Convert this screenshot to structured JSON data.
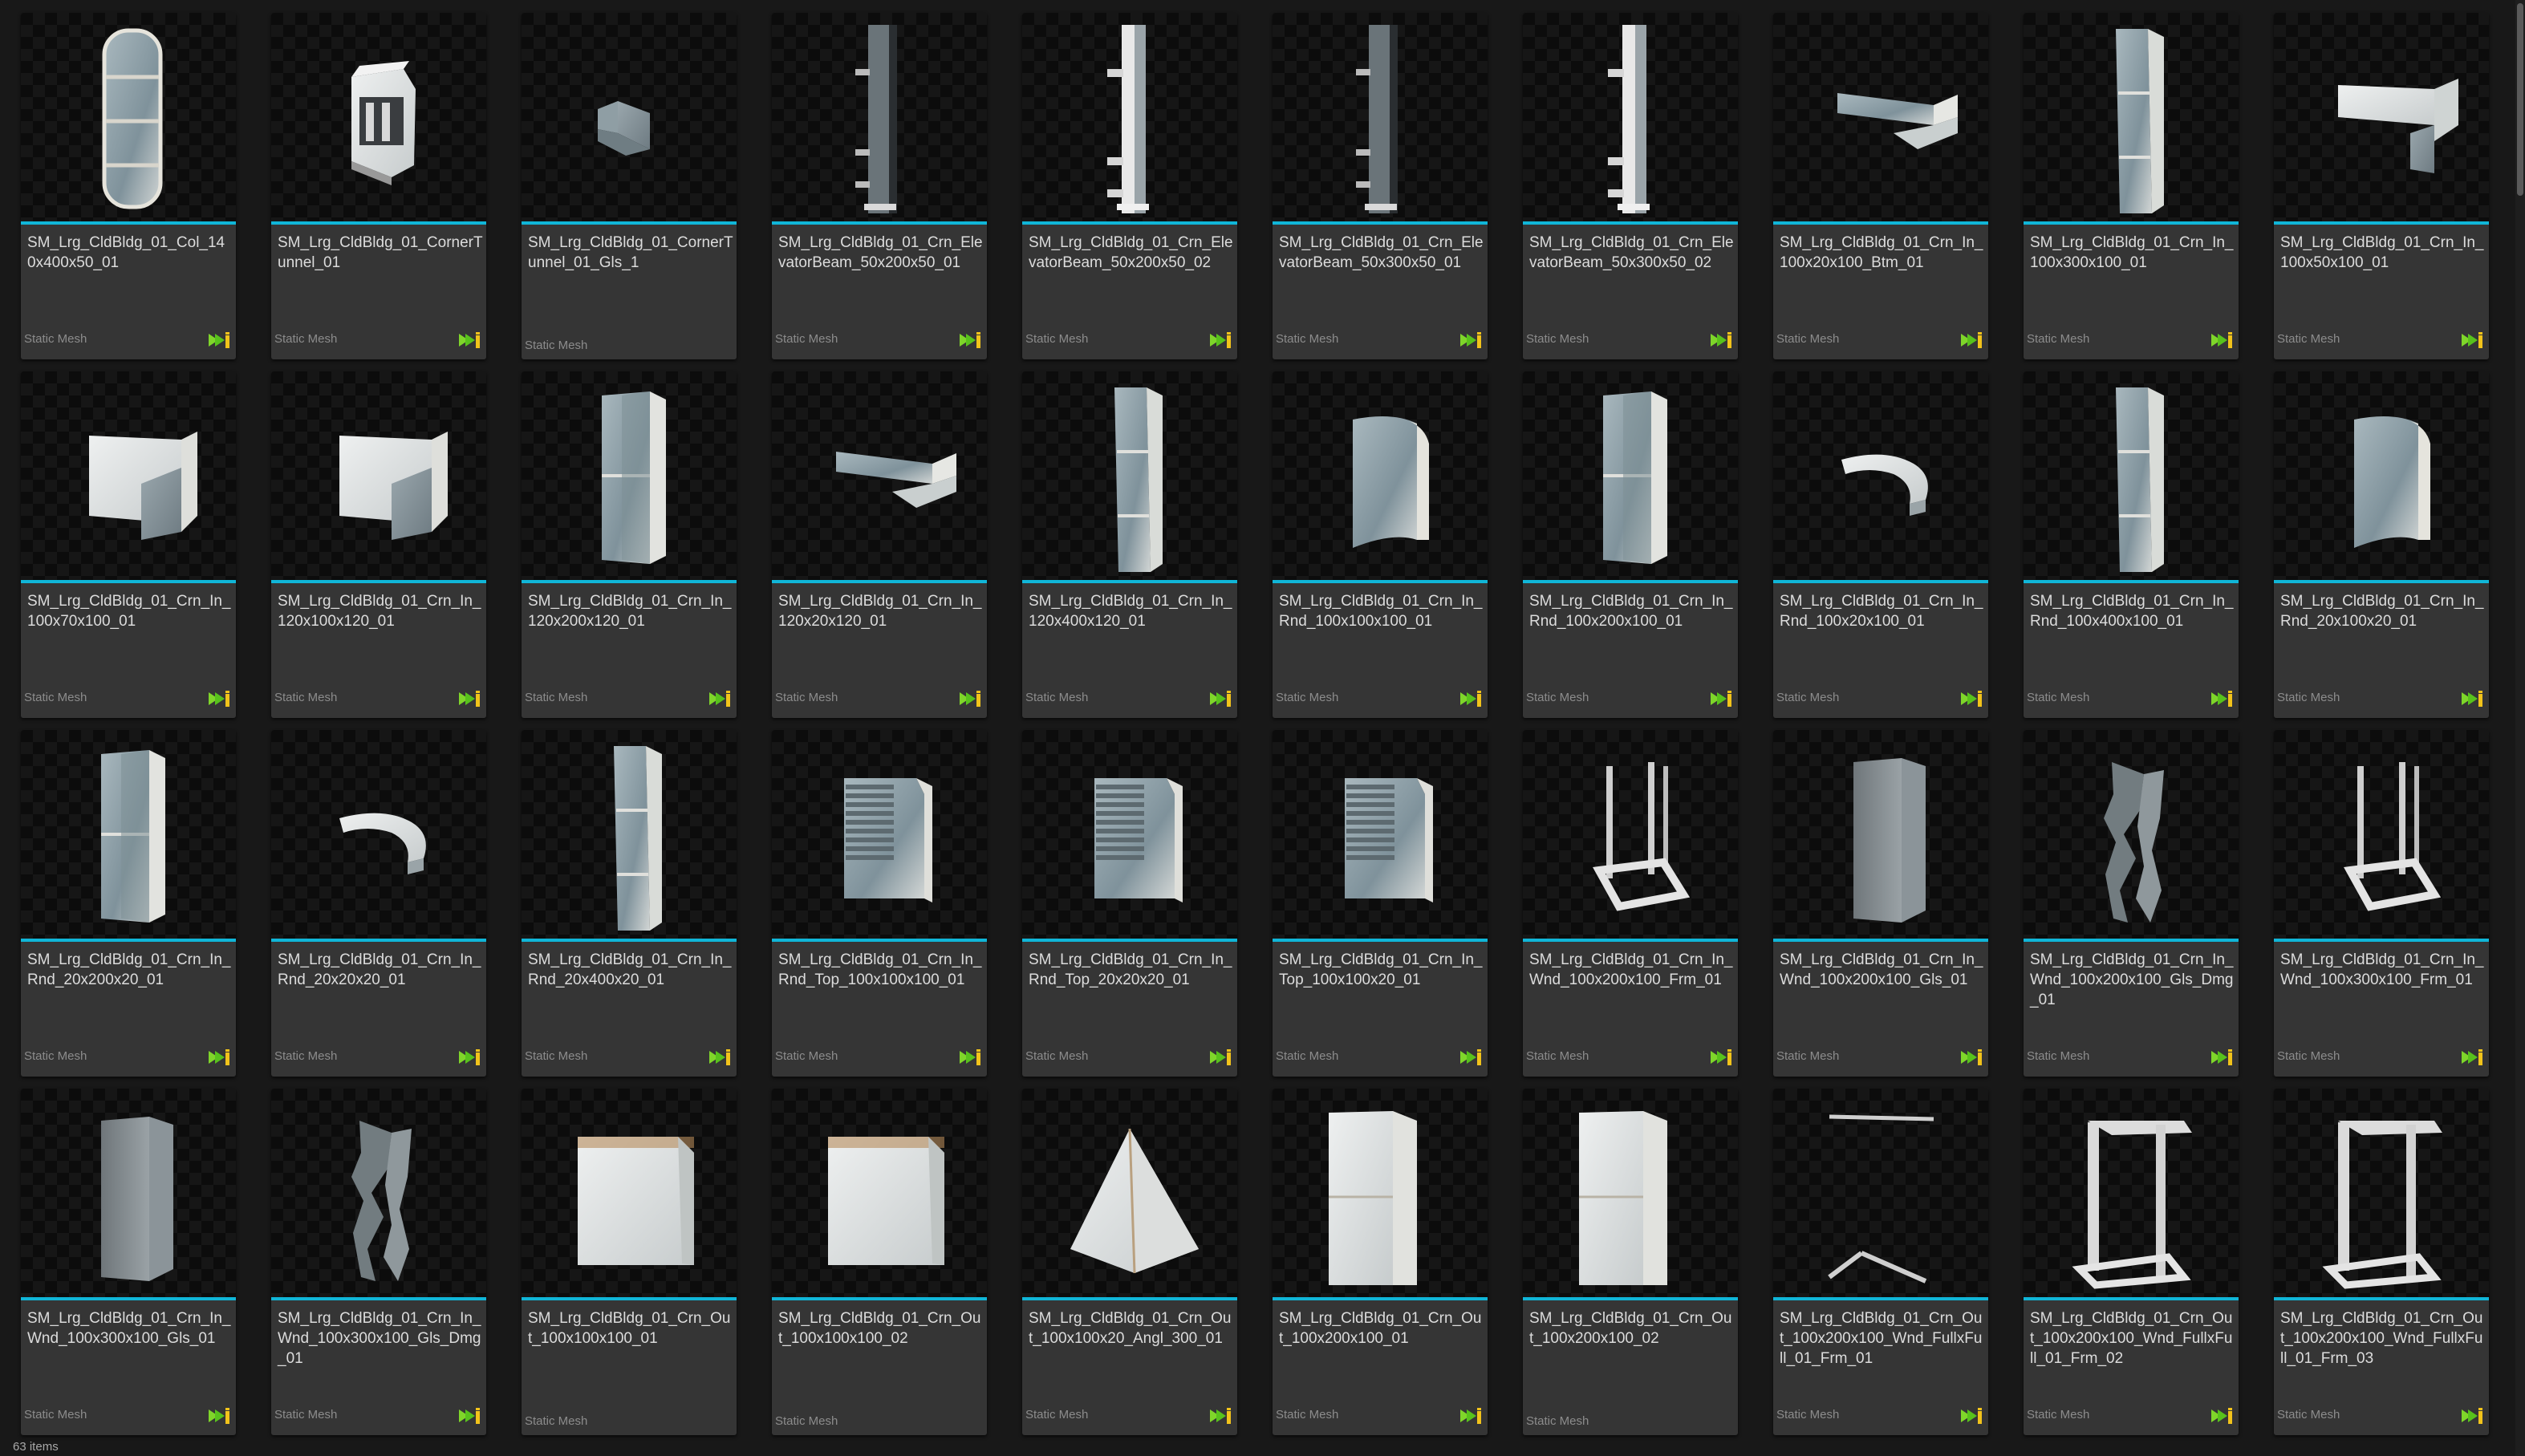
{
  "asset_type_label": "Static Mesh",
  "accent_color": "#10b6d8",
  "footer": {
    "item_count": "63 items"
  },
  "assets": [
    {
      "name": "SM_Lrg_CldBldg_01_Col_140x400x50_01",
      "shape": "column"
    },
    {
      "name": "SM_Lrg_CldBldg_01_CornerTunnel_01",
      "shape": "tunnel"
    },
    {
      "name": "SM_Lrg_CldBldg_01_CornerTunnel_01_Gls_1",
      "shape": "smallbracket",
      "no_badge": true
    },
    {
      "name": "SM_Lrg_CldBldg_01_Crn_ElevatorBeam_50x200x50_01",
      "shape": "beam"
    },
    {
      "name": "SM_Lrg_CldBldg_01_Crn_ElevatorBeam_50x200x50_02",
      "shape": "beamwhite"
    },
    {
      "name": "SM_Lrg_CldBldg_01_Crn_ElevatorBeam_50x300x50_01",
      "shape": "beam"
    },
    {
      "name": "SM_Lrg_CldBldg_01_Crn_ElevatorBeam_50x300x50_02",
      "shape": "beamwhite"
    },
    {
      "name": "SM_Lrg_CldBldg_01_Crn_In_100x20x100_Btm_01",
      "shape": "lthin"
    },
    {
      "name": "SM_Lrg_CldBldg_01_Crn_In_100x300x100_01",
      "shape": "tallpanel"
    },
    {
      "name": "SM_Lrg_CldBldg_01_Crn_In_100x50x100_01",
      "shape": "lshort"
    },
    {
      "name": "SM_Lrg_CldBldg_01_Crn_In_100x70x100_01",
      "shape": "cube"
    },
    {
      "name": "SM_Lrg_CldBldg_01_Crn_In_120x100x120_01",
      "shape": "cube"
    },
    {
      "name": "SM_Lrg_CldBldg_01_Crn_In_120x200x120_01",
      "shape": "tallsplit"
    },
    {
      "name": "SM_Lrg_CldBldg_01_Crn_In_120x20x120_01",
      "shape": "lthin"
    },
    {
      "name": "SM_Lrg_CldBldg_01_Crn_In_120x400x120_01",
      "shape": "tallpanel"
    },
    {
      "name": "SM_Lrg_CldBldg_01_Crn_In_Rnd_100x100x100_01",
      "shape": "round"
    },
    {
      "name": "SM_Lrg_CldBldg_01_Crn_In_Rnd_100x200x100_01",
      "shape": "tallsplit"
    },
    {
      "name": "SM_Lrg_CldBldg_01_Crn_In_Rnd_100x20x100_01",
      "shape": "roundthin"
    },
    {
      "name": "SM_Lrg_CldBldg_01_Crn_In_Rnd_100x400x100_01",
      "shape": "tallpanel"
    },
    {
      "name": "SM_Lrg_CldBldg_01_Crn_In_Rnd_20x100x20_01",
      "shape": "round"
    },
    {
      "name": "SM_Lrg_CldBldg_01_Crn_In_Rnd_20x200x20_01",
      "shape": "tallsplit"
    },
    {
      "name": "SM_Lrg_CldBldg_01_Crn_In_Rnd_20x20x20_01",
      "shape": "roundthin"
    },
    {
      "name": "SM_Lrg_CldBldg_01_Crn_In_Rnd_20x400x20_01",
      "shape": "tallpanel"
    },
    {
      "name": "SM_Lrg_CldBldg_01_Crn_In_Rnd_Top_100x100x100_01",
      "shape": "vent"
    },
    {
      "name": "SM_Lrg_CldBldg_01_Crn_In_Rnd_Top_20x20x20_01",
      "shape": "vent"
    },
    {
      "name": "SM_Lrg_CldBldg_01_Crn_In_Top_100x100x20_01",
      "shape": "vent"
    },
    {
      "name": "SM_Lrg_CldBldg_01_Crn_In_Wnd_100x200x100_Frm_01",
      "shape": "frame"
    },
    {
      "name": "SM_Lrg_CldBldg_01_Crn_In_Wnd_100x200x100_Gls_01",
      "shape": "glass"
    },
    {
      "name": "SM_Lrg_CldBldg_01_Crn_In_Wnd_100x200x100_Gls_Dmg_01",
      "shape": "broken"
    },
    {
      "name": "SM_Lrg_CldBldg_01_Crn_In_Wnd_100x300x100_Frm_01",
      "shape": "frame"
    },
    {
      "name": "SM_Lrg_CldBldg_01_Crn_In_Wnd_100x300x100_Gls_01",
      "shape": "glass"
    },
    {
      "name": "SM_Lrg_CldBldg_01_Crn_In_Wnd_100x300x100_Gls_Dmg_01",
      "shape": "broken"
    },
    {
      "name": "SM_Lrg_CldBldg_01_Crn_Out_100x100x100_01",
      "shape": "outcube",
      "no_badge": true
    },
    {
      "name": "SM_Lrg_CldBldg_01_Crn_Out_100x100x100_02",
      "shape": "outcube",
      "no_badge": true
    },
    {
      "name": "SM_Lrg_CldBldg_01_Crn_Out_100x100x20_Angl_300_01",
      "shape": "prism"
    },
    {
      "name": "SM_Lrg_CldBldg_01_Crn_Out_100x200x100_01",
      "shape": "outtall"
    },
    {
      "name": "SM_Lrg_CldBldg_01_Crn_Out_100x200x100_02",
      "shape": "outtall",
      "no_badge": true
    },
    {
      "name": "SM_Lrg_CldBldg_01_Crn_Out_100x200x100_Wnd_FullxFull_01_Frm_01",
      "shape": "lines"
    },
    {
      "name": "SM_Lrg_CldBldg_01_Crn_Out_100x200x100_Wnd_FullxFull_01_Frm_02",
      "shape": "cframe"
    },
    {
      "name": "SM_Lrg_CldBldg_01_Crn_Out_100x200x100_Wnd_FullxFull_01_Frm_03",
      "shape": "cframe"
    }
  ]
}
